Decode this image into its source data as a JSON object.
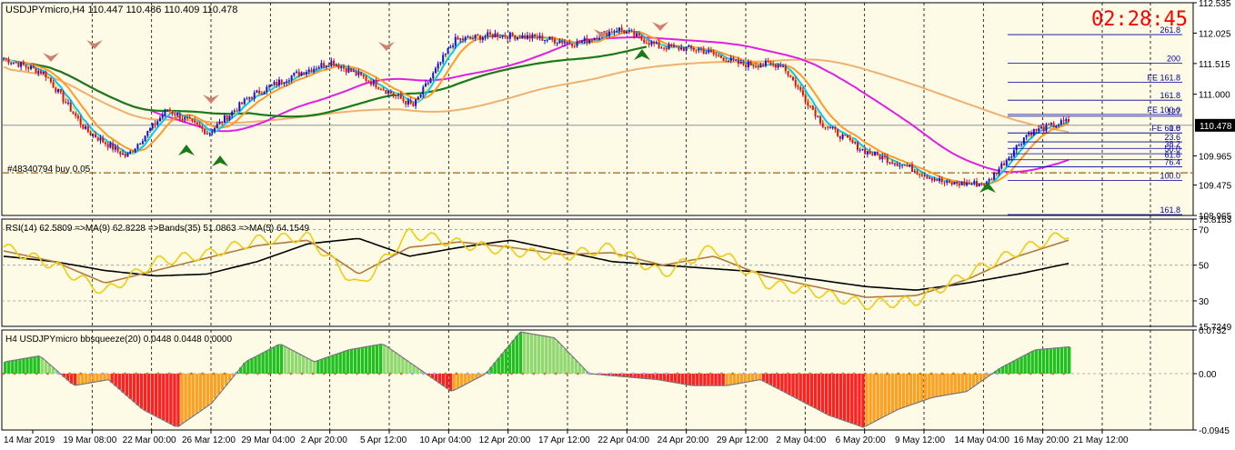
{
  "header": {
    "symbol_line": "USDJPYmicro,H4  110.447 110.486 110.409 110.478",
    "timer": "02:28:45"
  },
  "colors": {
    "background": "#fdfbe6",
    "bull": "#1010e0",
    "bear": "#e01010",
    "ma_fast": "#00c8ff",
    "ma_orange": "#ff9a2a",
    "ma_magenta": "#e020e0",
    "ma_green": "#1a7a1a",
    "ma_tan": "#f0b070",
    "rsi_yellow": "#f0cc10",
    "rsi_brown": "#b07a40",
    "rsi_black": "#000000",
    "hist_green": "#20c020",
    "hist_red": "#ff2020",
    "hist_orange": "#ffa020",
    "fib": "#0000a0",
    "timer": "#ff0000"
  },
  "chart_data": [
    {
      "type": "candlestick",
      "title": "USDJPYmicro,H4",
      "ylim": [
        108.965,
        112.535
      ],
      "y_ticks": [
        "112.535",
        "112.025",
        "111.515",
        "111.000",
        "110.478",
        "109.965",
        "109.475",
        "108.965"
      ],
      "current_price": "110.478",
      "trade_label": "#48340794 buy 0.05",
      "trade_price": 109.68,
      "fib_labels": [
        "261.8",
        "200",
        "FE 161.8",
        "161.8",
        "127",
        "FE 100.0",
        "0.0",
        "FE 61.8",
        "23.6",
        "38.2",
        "50.0",
        "61.8",
        "76.4",
        "100.0",
        "161.8"
      ],
      "fib_levels": [
        112.0,
        111.52,
        111.2,
        110.9,
        110.63,
        110.66,
        110.35,
        110.35,
        110.2,
        110.09,
        110.0,
        109.9,
        109.78,
        109.55,
        108.98
      ],
      "close_path": [
        111.6,
        111.35,
        110.4,
        109.95,
        110.75,
        110.35,
        110.95,
        111.3,
        111.55,
        111.2,
        110.8,
        111.9,
        112.0,
        111.95,
        111.85,
        112.1,
        111.8,
        111.75,
        111.5,
        111.5,
        110.5,
        110.05,
        109.8,
        109.5,
        109.5,
        110.35,
        110.55
      ]
    },
    {
      "type": "line",
      "title": "RSI(14) 62.5809  =>MA(9) 62.8228  =>Bands(35) 51.0863  =>MA(5) 64.1549",
      "ylim": [
        15.7249,
        75.8153
      ],
      "y_ticks": [
        "75.8153",
        "70",
        "50",
        "30",
        "15.7249"
      ],
      "series": [
        {
          "name": "RSI(14)",
          "values": [
            60,
            50,
            35,
            52,
            56,
            64,
            66,
            38,
            68,
            62,
            58,
            55,
            60,
            45,
            60,
            40,
            35,
            28,
            30,
            45,
            58,
            68
          ]
        },
        {
          "name": "MA(9)",
          "values": [
            58,
            52,
            40,
            47,
            54,
            61,
            64,
            45,
            60,
            63,
            60,
            56,
            57,
            50,
            55,
            44,
            38,
            32,
            33,
            42,
            55,
            64
          ]
        },
        {
          "name": "Bands(35)",
          "values": [
            55,
            52,
            47,
            44,
            45,
            52,
            62,
            65,
            55,
            60,
            64,
            58,
            52,
            50,
            48,
            46,
            42,
            38,
            36,
            40,
            45,
            51
          ]
        }
      ]
    },
    {
      "type": "bar",
      "title": "H4 USDJPYmicro bbsqueeze(20) 0.0448 0.0448 0.0000",
      "ylim": [
        -0.0945,
        0.0732
      ],
      "y_ticks": [
        "0.0732",
        "0.00",
        "-0.0945"
      ],
      "values": [
        0.02,
        0.03,
        -0.02,
        -0.01,
        -0.06,
        -0.09,
        -0.05,
        0.02,
        0.05,
        0.02,
        0.04,
        0.05,
        0.01,
        -0.03,
        0.0,
        0.07,
        0.06,
        0.0,
        -0.005,
        -0.01,
        -0.02,
        -0.02,
        -0.01,
        -0.04,
        -0.07,
        -0.09,
        -0.06,
        -0.04,
        -0.03,
        0.01,
        0.04,
        0.045
      ]
    }
  ],
  "x_axis": {
    "labels": [
      "14 Mar 2019",
      "19 Mar 08:00",
      "22 Mar 00:00",
      "26 Mar 12:00",
      "29 Mar 04:00",
      "2 Apr 20:00",
      "5 Apr 12:00",
      "10 Apr 04:00",
      "12 Apr 20:00",
      "17 Apr 12:00",
      "22 Apr 04:00",
      "24 Apr 20:00",
      "29 Apr 12:00",
      "2 May 04:00",
      "6 May 20:00",
      "9 May 12:00",
      "14 May 04:00",
      "16 May 20:00",
      "21 May 12:00"
    ]
  }
}
